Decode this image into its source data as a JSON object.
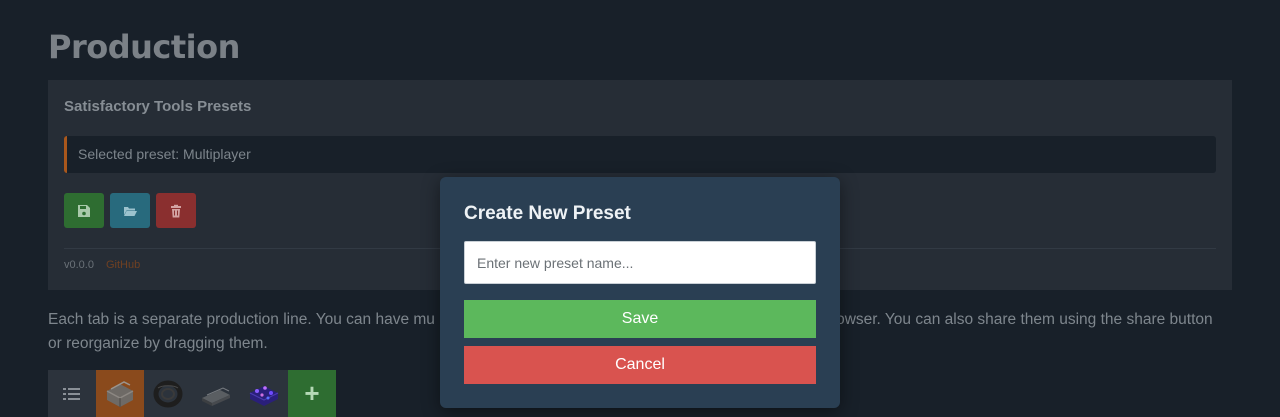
{
  "page": {
    "title": "Production"
  },
  "presets": {
    "title": "Satisfactory Tools Presets",
    "selected_text": "Selected preset: Multiplayer",
    "buttons": [
      {
        "icon": "save-icon",
        "color": "#2e6d31"
      },
      {
        "icon": "folder-open-icon",
        "color": "#286a7d"
      },
      {
        "icon": "trash-icon",
        "color": "#8a2f2f"
      }
    ],
    "version": "v0.0.0",
    "github_label": "GitHub"
  },
  "description": "Each tab is a separate production line. You can have mu                                                                                                   rowser. You can also share them using the share button or reorganize by dragging them.",
  "description_parts": {
    "left": "Each tab is a separate production line. You can have mu",
    "right": "rowser. You can also share them using the share button",
    "line2": "or reorganize by dragging them."
  },
  "tabs": [
    {
      "icon": "list-icon"
    },
    {
      "icon": "concrete-icon",
      "active": true
    },
    {
      "icon": "wire-icon"
    },
    {
      "icon": "plate-icon"
    },
    {
      "icon": "crystal-icon"
    },
    {
      "label": "+"
    }
  ],
  "modal": {
    "title": "Create New Preset",
    "input_placeholder": "Enter new preset name...",
    "input_value": "",
    "save_label": "Save",
    "cancel_label": "Cancel",
    "colors": {
      "save": "#5cb85c",
      "cancel": "#d9534f",
      "background": "#2a3f53"
    }
  }
}
